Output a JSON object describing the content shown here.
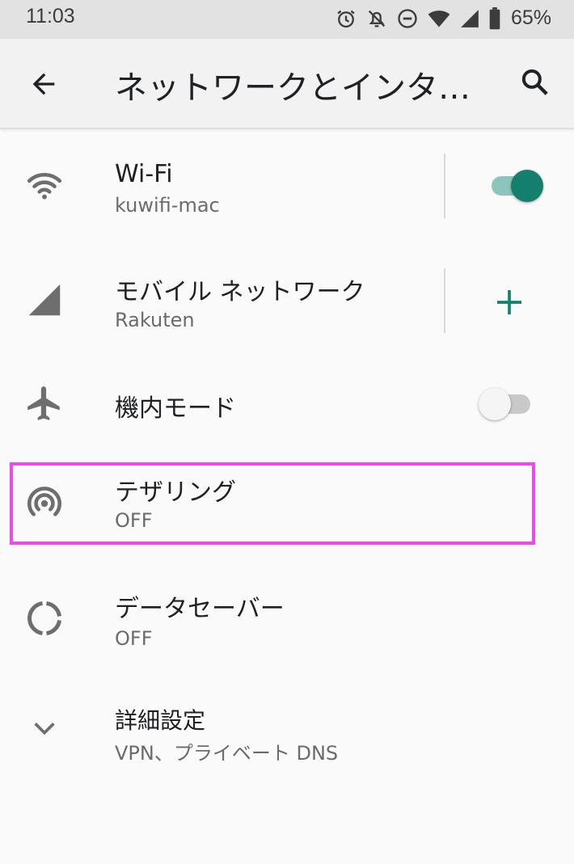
{
  "status_bar": {
    "time": "11:03",
    "battery": "65%",
    "icons": [
      "alarm-icon",
      "notifications-off-icon",
      "do-not-disturb-icon",
      "wifi-icon",
      "cell-signal-icon",
      "battery-icon"
    ]
  },
  "app_bar": {
    "title": "ネットワークとインタ…",
    "back_icon": "arrow-back-icon",
    "search_icon": "search-icon"
  },
  "items": [
    {
      "title": "Wi-Fi",
      "subtitle": "kuwifi-mac",
      "icon": "wifi-icon",
      "control": "toggle",
      "toggle_on": true
    },
    {
      "title": "モバイル ネットワーク",
      "subtitle": "Rakuten",
      "icon": "cell-signal-icon",
      "control": "add-button"
    },
    {
      "title": "機内モード",
      "icon": "airplane-icon",
      "control": "toggle",
      "toggle_on": false
    },
    {
      "title": "テザリング",
      "subtitle": "OFF",
      "icon": "hotspot-icon",
      "highlighted": true
    },
    {
      "title": "データセーバー",
      "subtitle": "OFF",
      "icon": "data-saver-icon"
    },
    {
      "title": "詳細設定",
      "subtitle": "VPN、プライベート DNS",
      "icon": "chevron-down-icon"
    }
  ],
  "colors": {
    "accent": "#137f6c",
    "accent_track": "#8cc5bb",
    "highlight_border": "#ef48ef",
    "icon_gray": "#6e6e6e"
  }
}
